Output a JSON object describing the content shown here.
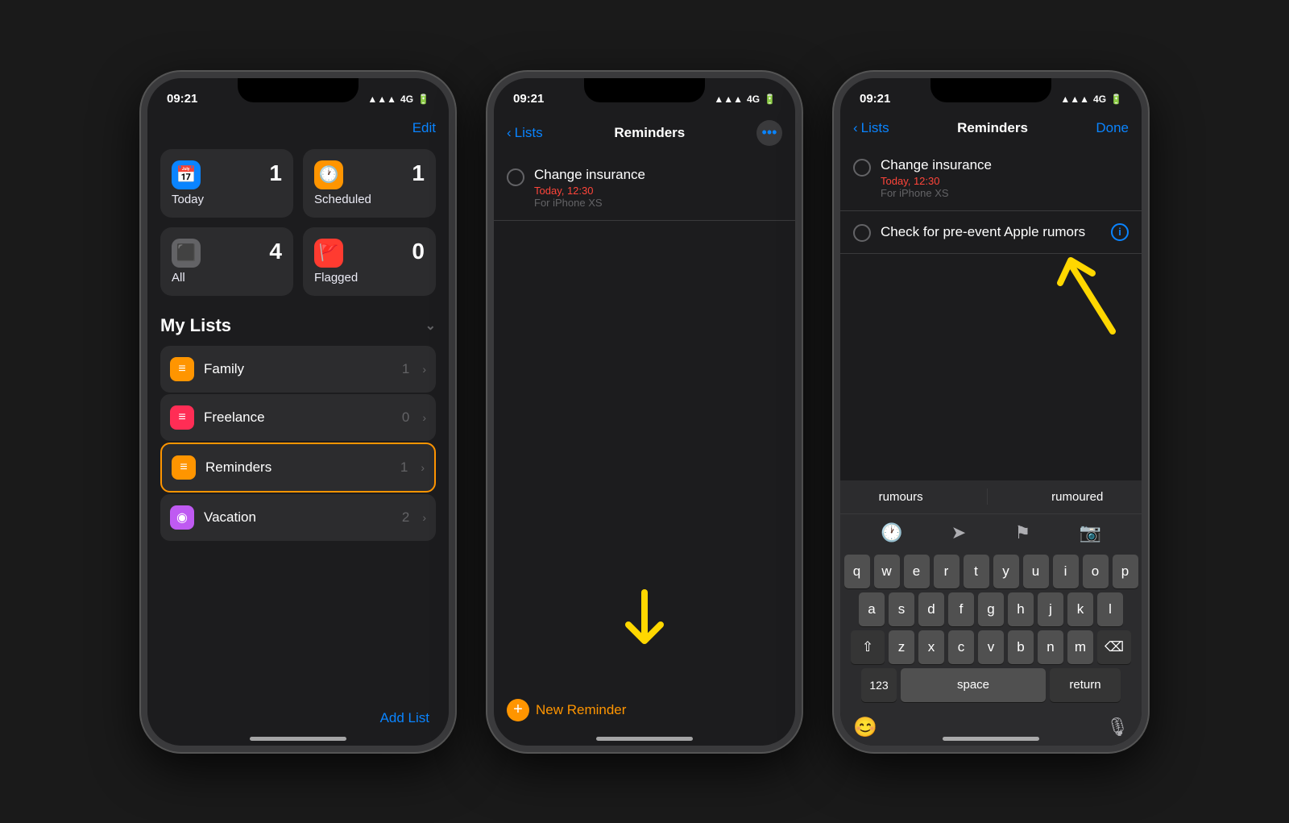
{
  "phone1": {
    "status_time": "09:21",
    "status_signal": "▲▲▲",
    "status_network": "4G",
    "header": {
      "edit_label": "Edit"
    },
    "cards": [
      {
        "id": "today",
        "icon": "📅",
        "icon_class": "blue",
        "count": "1",
        "label": "Today"
      },
      {
        "id": "scheduled",
        "icon": "🕐",
        "icon_class": "orange",
        "count": "1",
        "label": "Scheduled"
      },
      {
        "id": "all",
        "icon": "⬛",
        "icon_class": "gray",
        "count": "4",
        "label": "All"
      },
      {
        "id": "flagged",
        "icon": "🚩",
        "icon_class": "red",
        "count": "0",
        "label": "Flagged"
      }
    ],
    "my_lists_label": "My Lists",
    "lists": [
      {
        "id": "family",
        "icon": "≡",
        "icon_class": "orange",
        "name": "Family",
        "count": "1"
      },
      {
        "id": "freelance",
        "icon": "≡",
        "icon_class": "pink",
        "name": "Freelance",
        "count": "0"
      },
      {
        "id": "reminders",
        "icon": "≡",
        "icon_class": "orange",
        "name": "Reminders",
        "count": "1",
        "highlighted": true
      },
      {
        "id": "vacation",
        "icon": "◉",
        "icon_class": "purple",
        "name": "Vacation",
        "count": "2"
      }
    ],
    "add_list_label": "Add List"
  },
  "phone2": {
    "status_time": "09:21",
    "nav": {
      "back_label": "Lists",
      "title": "Reminders",
      "dots": "•••"
    },
    "reminders": [
      {
        "id": "change-insurance",
        "title": "Change insurance",
        "sub": "Today, 12:30",
        "sub2": "For iPhone XS"
      }
    ],
    "new_reminder_label": "New Reminder"
  },
  "phone3": {
    "status_time": "09:21",
    "nav": {
      "back_label": "Lists",
      "title": "Reminders",
      "done_label": "Done"
    },
    "reminders": [
      {
        "id": "change-insurance",
        "title": "Change insurance",
        "sub": "Today, 12:30",
        "sub2": "For iPhone XS",
        "has_info": false
      },
      {
        "id": "check-rumors",
        "title": "Check for pre-event Apple rumors",
        "has_info": true
      }
    ],
    "autocorrect": [
      "rumours",
      "rumoured"
    ],
    "toolbar_icons": [
      "clock",
      "location",
      "flag",
      "camera"
    ],
    "keyboard": {
      "rows": [
        [
          "q",
          "w",
          "e",
          "r",
          "t",
          "y",
          "u",
          "i",
          "o",
          "p"
        ],
        [
          "a",
          "s",
          "d",
          "f",
          "g",
          "h",
          "j",
          "k",
          "l"
        ],
        [
          "⇧",
          "z",
          "x",
          "c",
          "v",
          "b",
          "n",
          "m",
          "⌫"
        ],
        [
          "123",
          "space",
          "return"
        ]
      ],
      "space_label": "space",
      "return_label": "return",
      "num_label": "123"
    }
  }
}
